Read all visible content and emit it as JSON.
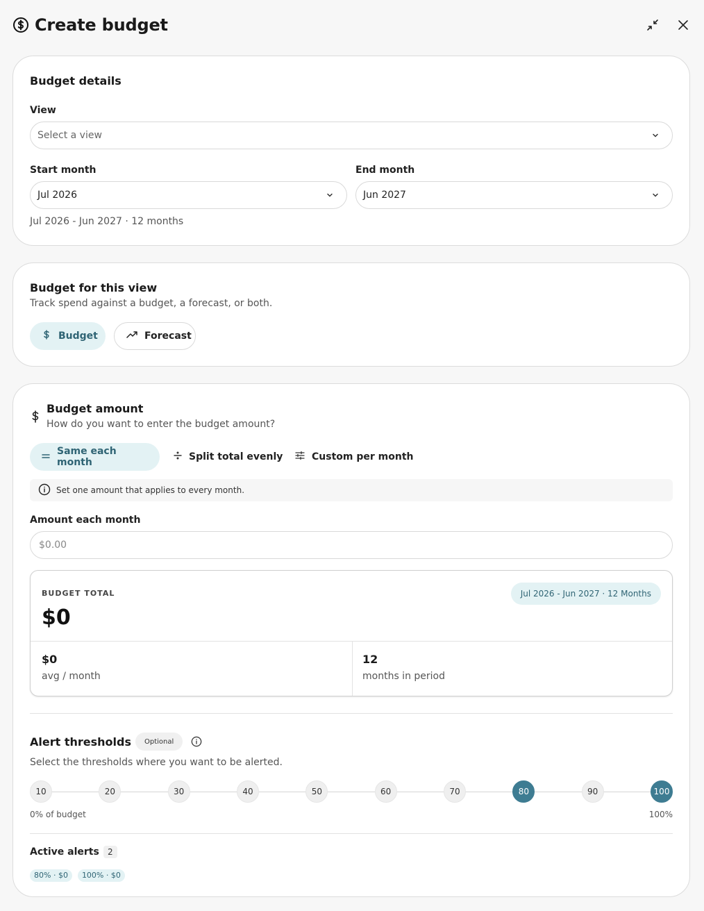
{
  "header": {
    "title": "Create budget"
  },
  "details": {
    "title": "Budget details",
    "view_label": "View",
    "view_placeholder": "Select a view",
    "start_label": "Start month",
    "start_value": "Jul 2026",
    "end_label": "End month",
    "end_value": "Jun 2027",
    "summary": "Jul 2026 - Jun 2027 · 12 months"
  },
  "view_budget": {
    "title": "Budget for this view",
    "subtitle": "Track spend against a budget, a forecast, or both.",
    "budget_label": "Budget",
    "forecast_label": "Forecast"
  },
  "amount": {
    "title": "Budget amount",
    "subtitle": "How do you want to enter the budget amount?",
    "modes": [
      "Same each month",
      "Split total evenly",
      "Custom per month"
    ],
    "info": "Set one amount that applies to every month.",
    "field_label": "Amount each month",
    "field_placeholder": "$0.00",
    "total_label": "BUDGET TOTAL",
    "total_value": "$0",
    "period_pill": "Jul 2026 - Jun 2027 · 12 Months",
    "avg_value": "$0",
    "avg_label": "avg / month",
    "months_value": "12",
    "months_label": "months in period"
  },
  "alerts": {
    "title": "Alert thresholds",
    "optional": "Optional",
    "subtitle": "Select the thresholds where you want to be alerted.",
    "thresholds": [
      "10",
      "20",
      "30",
      "40",
      "50",
      "60",
      "70",
      "80",
      "90",
      "100"
    ],
    "selected": [
      "80",
      "100"
    ],
    "min_label": "0% of budget",
    "max_label": "100%",
    "active_label": "Active alerts",
    "active_count": "2",
    "active_chips": [
      "80% · $0",
      "100% · $0"
    ]
  },
  "colors": {
    "accent": "#3e7c92",
    "accent_soft": "#e3f2f4",
    "accent_text": "#2f6474"
  }
}
